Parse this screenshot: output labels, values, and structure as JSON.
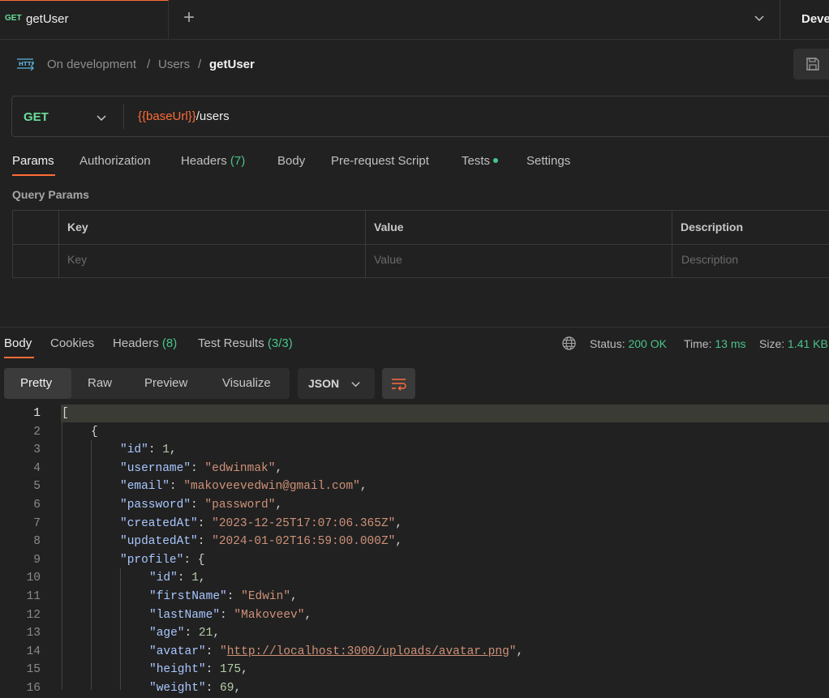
{
  "tabs": [
    {
      "method": "GET",
      "name": "getUser"
    }
  ],
  "environment": {
    "label": "Deve"
  },
  "breadcrumb": {
    "items": [
      "On development",
      "Users"
    ],
    "separator": "/",
    "current": "getUser"
  },
  "request": {
    "method": "GET",
    "url_variable": "{{baseUrl}}",
    "url_path": "/users"
  },
  "request_tabs": {
    "params": "Params",
    "authorization": "Authorization",
    "headers": "Headers",
    "headers_count": "(7)",
    "body": "Body",
    "prerequest": "Pre-request Script",
    "tests": "Tests",
    "settings": "Settings"
  },
  "query_params": {
    "title": "Query Params",
    "columns": [
      "Key",
      "Value",
      "Description"
    ],
    "placeholders": [
      "Key",
      "Value",
      "Description"
    ]
  },
  "response_tabs": {
    "body": "Body",
    "cookies": "Cookies",
    "headers": "Headers",
    "headers_count": "(8)",
    "test_results": "Test Results",
    "test_results_count": "(3/3)"
  },
  "status": {
    "status_label": "Status:",
    "status_value": "200 OK",
    "time_label": "Time:",
    "time_value": "13 ms",
    "size_label": "Size:",
    "size_value": "1.41 KB"
  },
  "view_modes": [
    "Pretty",
    "Raw",
    "Preview",
    "Visualize"
  ],
  "format": "JSON",
  "code_lines": [
    {
      "n": "1",
      "text": "["
    },
    {
      "n": "2",
      "text": "{"
    },
    {
      "n": "3",
      "key": "\"id\"",
      "num": "1"
    },
    {
      "n": "4",
      "key": "\"username\"",
      "str": "\"edwinmak\""
    },
    {
      "n": "5",
      "key": "\"email\"",
      "str": "\"makoveevedwin@gmail.com\""
    },
    {
      "n": "6",
      "key": "\"password\"",
      "str": "\"password\""
    },
    {
      "n": "7",
      "key": "\"createdAt\"",
      "str": "\"2023-12-25T17:07:06.365Z\""
    },
    {
      "n": "8",
      "key": "\"updatedAt\"",
      "str": "\"2024-01-02T16:59:00.000Z\""
    },
    {
      "n": "9",
      "key": "\"profile\"",
      "open": "{"
    },
    {
      "n": "10",
      "key": "\"id\"",
      "num": "1"
    },
    {
      "n": "11",
      "key": "\"firstName\"",
      "str": "\"Edwin\""
    },
    {
      "n": "12",
      "key": "\"lastName\"",
      "str": "\"Makoveev\""
    },
    {
      "n": "13",
      "key": "\"age\"",
      "num": "21"
    },
    {
      "n": "14",
      "key": "\"avatar\"",
      "link": "http://localhost:3000/uploads/avatar.png"
    },
    {
      "n": "15",
      "key": "\"height\"",
      "num": "175"
    },
    {
      "n": "16",
      "key": "\"weight\"",
      "num": "69"
    }
  ],
  "colors": {
    "accent": "#ff6c37",
    "get_method": "#6bdd9a",
    "success": "#49c48a",
    "background": "#212121"
  }
}
